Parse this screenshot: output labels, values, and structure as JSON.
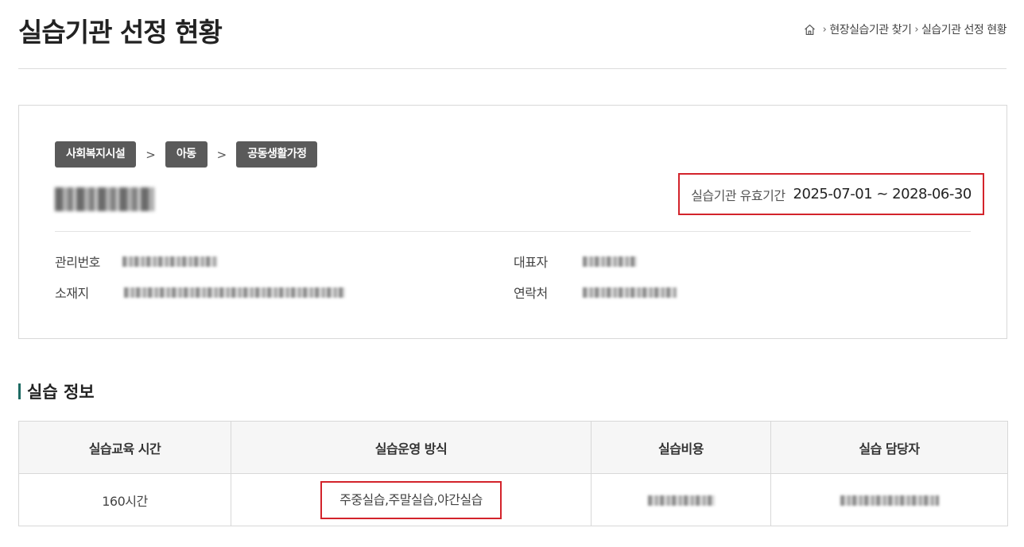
{
  "header": {
    "title": "실습기관 선정 현황",
    "breadcrumb": [
      "현장실습기관 찾기",
      "실습기관 선정 현황"
    ]
  },
  "institution": {
    "categories": [
      "사회복지시설",
      "아동",
      "공동생활가정"
    ],
    "validity_label": "실습기관 유효기간",
    "validity_value": "2025-07-01 ~ 2028-06-30",
    "fields": {
      "management_no_label": "관리번호",
      "location_label": "소재지",
      "representative_label": "대표자",
      "contact_label": "연락처"
    }
  },
  "practice": {
    "section_title": "실습 정보",
    "headers": [
      "실습교육 시간",
      "실습운영 방식",
      "실습비용",
      "실습 담당자"
    ],
    "hours": "160시간",
    "operation": "주중실습,주말실습,야간실습"
  },
  "colors": {
    "highlight": "#d3232b",
    "badge": "#5a5a5a",
    "section_bar": "#1e6b63"
  }
}
